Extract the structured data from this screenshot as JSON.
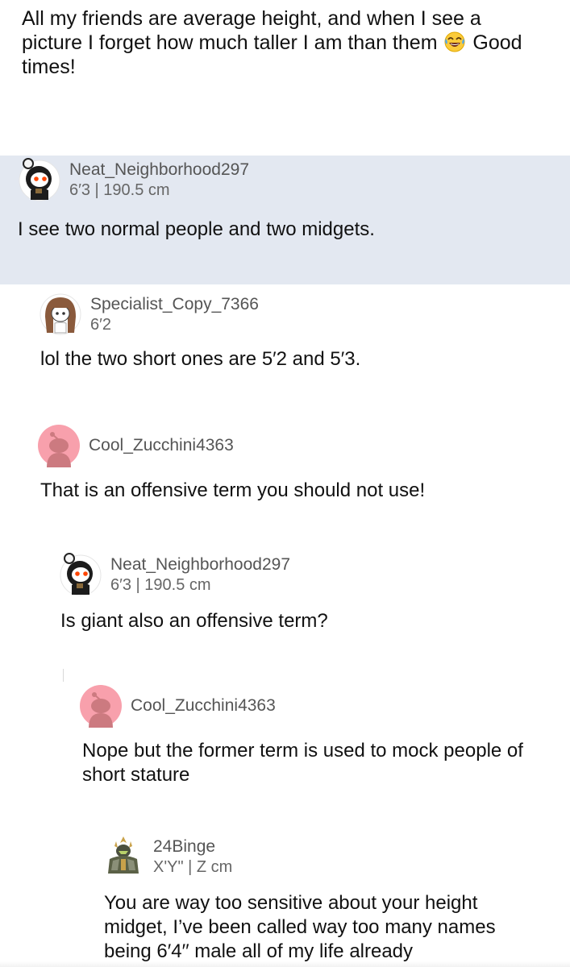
{
  "post": {
    "text_before_emoji": "All my friends are average height, and when I see a picture I forget how much taller I am than them",
    "emoji_icon": "face-with-tears-of-joy",
    "text_after_emoji": "Good times!"
  },
  "colors": {
    "highlight_background": "#e3e8f1",
    "username_gray": "#555555",
    "snoo_orange": "#ff4500",
    "default_avatar_pink": "#f8a0ac"
  },
  "comments": [
    {
      "username": "Neat_Neighborhood297",
      "flair": "6′3 | 190.5 cm",
      "avatar_icon": "snoo-hooded-avatar",
      "text": "I see two normal people and two midgets.",
      "highlighted": true
    },
    {
      "username": "Specialist_Copy_7366",
      "flair": "6′2",
      "avatar_icon": "brown-hair-girl-avatar",
      "text": "lol the two short ones are 5′2 and 5′3."
    },
    {
      "username": "Cool_Zucchini4363",
      "flair": "",
      "avatar_icon": "default-snoo-pink-avatar",
      "text": "That is an offensive term you should not use!"
    },
    {
      "username": "Neat_Neighborhood297",
      "flair": "6′3 | 190.5 cm",
      "avatar_icon": "snoo-hooded-avatar",
      "text": "Is giant also an offensive term?"
    },
    {
      "username": "Cool_Zucchini4363",
      "flair": "",
      "avatar_icon": "default-snoo-pink-avatar",
      "text": "Nope but the former term is used to mock people of short stature"
    },
    {
      "username": "24Binge",
      "flair": "X'Y\" | Z cm",
      "avatar_icon": "armored-knight-avatar",
      "text": "You are way too sensitive about your height midget, I’ve been called way too many names being 6′4′′ male all of my life already"
    }
  ]
}
